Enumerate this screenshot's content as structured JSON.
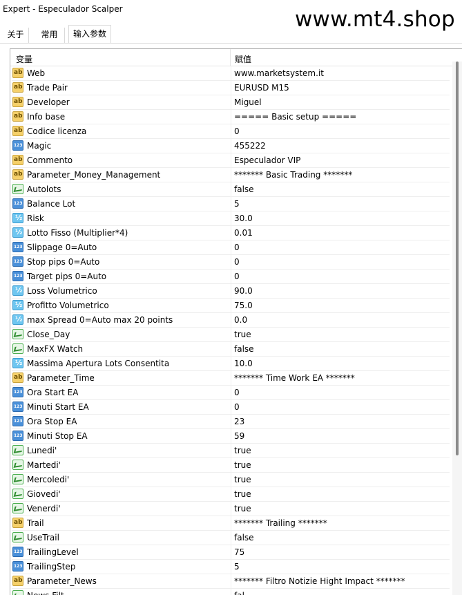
{
  "window": {
    "title": "Expert - Especulador Scalper",
    "watermark": "www.mt4.shop"
  },
  "tabs": [
    {
      "label": "关于",
      "active": false
    },
    {
      "label": "常用",
      "active": false
    },
    {
      "label": "输入参数",
      "active": true
    }
  ],
  "table": {
    "headers": {
      "name": "变量",
      "value": "赋值"
    },
    "rows": [
      {
        "type": "string",
        "name": "Web",
        "value": "www.marketsystem.it"
      },
      {
        "type": "string",
        "name": "Trade Pair",
        "value": " EURUSD M15"
      },
      {
        "type": "string",
        "name": "Developer",
        "value": "Miguel"
      },
      {
        "type": "string",
        "name": "Info base",
        "value": "===== Basic setup ====="
      },
      {
        "type": "string",
        "name": "Codice licenza",
        "value": "0"
      },
      {
        "type": "int",
        "name": "Magic",
        "value": "455222"
      },
      {
        "type": "string",
        "name": "Commento",
        "value": "Especulador VIP"
      },
      {
        "type": "string",
        "name": "Parameter_Money_Management",
        "value": "******* Basic Trading *******"
      },
      {
        "type": "bool",
        "name": "Autolots",
        "value": "false"
      },
      {
        "type": "int",
        "name": "Balance Lot",
        "value": "5"
      },
      {
        "type": "double",
        "name": "Risk",
        "value": "30.0"
      },
      {
        "type": "double",
        "name": "Lotto Fisso (Multiplier*4)",
        "value": "0.01"
      },
      {
        "type": "int",
        "name": "Slippage 0=Auto",
        "value": "0"
      },
      {
        "type": "int",
        "name": "Stop pips  0=Auto",
        "value": "0"
      },
      {
        "type": "int",
        "name": "Target pips  0=Auto",
        "value": "0"
      },
      {
        "type": "double",
        "name": "Loss Volumetrico",
        "value": "90.0"
      },
      {
        "type": "double",
        "name": "Profitto Volumetrico",
        "value": "75.0"
      },
      {
        "type": "double",
        "name": "max Spread  0=Auto max 20 points",
        "value": "0.0"
      },
      {
        "type": "bool",
        "name": "Close_Day",
        "value": "true"
      },
      {
        "type": "bool",
        "name": "MaxFX Watch",
        "value": "false"
      },
      {
        "type": "double",
        "name": "Massima Apertura Lots Consentita",
        "value": "10.0"
      },
      {
        "type": "string",
        "name": "Parameter_Time",
        "value": "******* Time Work EA *******"
      },
      {
        "type": "int",
        "name": "Ora Start EA",
        "value": "0"
      },
      {
        "type": "int",
        "name": "Minuti Start EA",
        "value": "0"
      },
      {
        "type": "int",
        "name": "Ora Stop EA",
        "value": "23"
      },
      {
        "type": "int",
        "name": "Minuti Stop EA",
        "value": "59"
      },
      {
        "type": "bool",
        "name": "Lunedi'",
        "value": "true"
      },
      {
        "type": "bool",
        "name": "Martedi'",
        "value": "true"
      },
      {
        "type": "bool",
        "name": "Mercoledi'",
        "value": "true"
      },
      {
        "type": "bool",
        "name": "Giovedi'",
        "value": "true"
      },
      {
        "type": "bool",
        "name": "Venerdi'",
        "value": "true"
      },
      {
        "type": "string",
        "name": "Trail",
        "value": "******* Trailing  *******"
      },
      {
        "type": "bool",
        "name": "UseTrail",
        "value": "false"
      },
      {
        "type": "int",
        "name": "TrailingLevel",
        "value": "75"
      },
      {
        "type": "int",
        "name": "TrailingStep",
        "value": "5"
      },
      {
        "type": "string",
        "name": "Parameter_News",
        "value": "******* Filtro Notizie Hight Impact  *******"
      },
      {
        "type": "bool",
        "name": "News Filt",
        "value": "fal"
      }
    ]
  }
}
